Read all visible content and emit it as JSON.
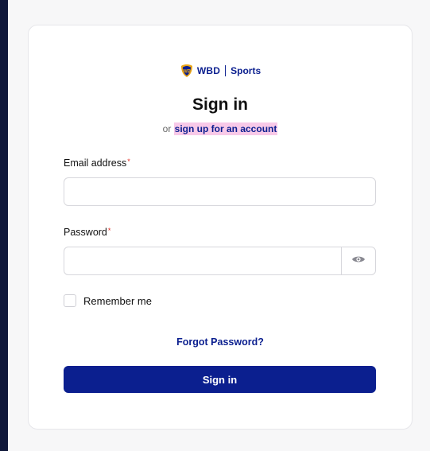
{
  "brand": {
    "name": "WBD",
    "product": "Sports"
  },
  "heading": "Sign in",
  "signup": {
    "prefix": "or",
    "link_label": "sign up for an account"
  },
  "email": {
    "label": "Email address",
    "required_mark": "*",
    "value": "",
    "placeholder": ""
  },
  "password": {
    "label": "Password",
    "required_mark": "*",
    "value": "",
    "placeholder": "",
    "toggle_icon": "eye-icon"
  },
  "remember": {
    "label": "Remember me",
    "checked": false
  },
  "forgot_label": "Forgot Password?",
  "submit_label": "Sign in",
  "colors": {
    "primary": "#0b1f8f",
    "highlight": "#f8c9e8",
    "required": "#e0281e",
    "page_bg": "#1a2140"
  }
}
